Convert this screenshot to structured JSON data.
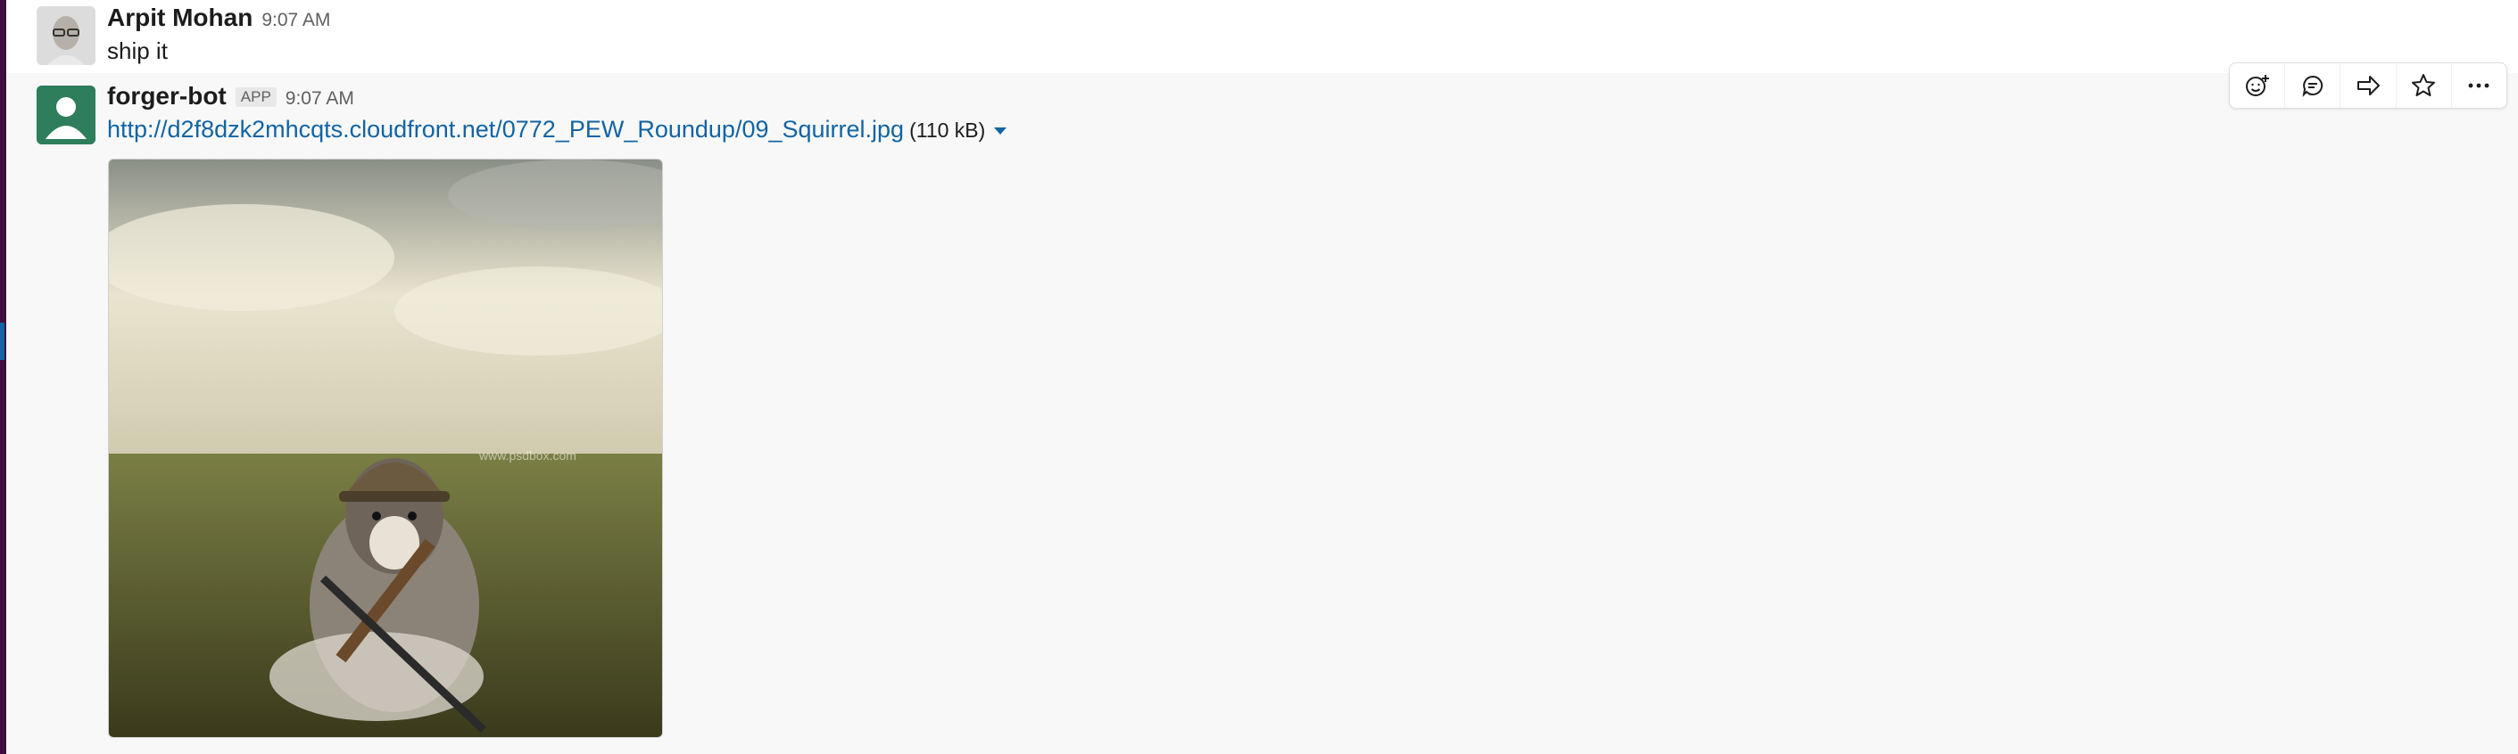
{
  "messages": [
    {
      "user": "Arpit Mohan",
      "time": "9:07 AM",
      "text": "ship it"
    },
    {
      "user": "forger-bot",
      "badge": "APP",
      "time": "9:07 AM",
      "attachment": {
        "url": "http://d2f8dzk2mhcqts.cloudfront.net/0772_PEW_Roundup/09_Squirrel.jpg",
        "size": "(110 kB)",
        "image_watermark": "www.psdbox.com"
      }
    }
  ],
  "message_actions": [
    {
      "icon": "add-reaction-icon"
    },
    {
      "icon": "reply-in-thread-icon"
    },
    {
      "icon": "share-message-icon"
    },
    {
      "icon": "star-icon"
    },
    {
      "icon": "more-actions-icon"
    }
  ],
  "colors": {
    "link": "#1264a3",
    "sidebar": "#3f0e40",
    "hover_background": "#f8f8f8",
    "bot_avatar": "#2e7d5b"
  }
}
